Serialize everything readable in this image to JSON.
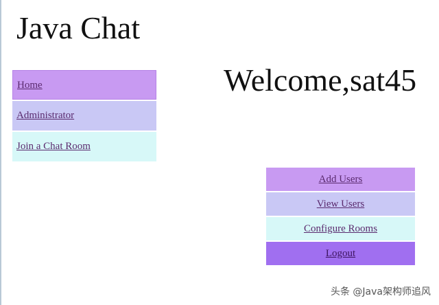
{
  "header": {
    "app_title": "Java Chat",
    "welcome": "Welcome,sat45"
  },
  "sidebar": {
    "items": [
      {
        "label": "Home"
      },
      {
        "label": "Administrator"
      },
      {
        "label": "Join a Chat Room"
      }
    ]
  },
  "actions": {
    "items": [
      {
        "label": "Add Users"
      },
      {
        "label": "View Users"
      },
      {
        "label": "Configure Rooms"
      },
      {
        "label": "Logout"
      }
    ]
  },
  "watermark": "头条 @Java架构师追风",
  "colors": {
    "nav_home_bg": "#c89af2",
    "nav_admin_bg": "#c9c8f5",
    "nav_join_bg": "#d7f8f8",
    "logout_bg": "#a06ff0",
    "link_color": "#5a2a6e"
  }
}
